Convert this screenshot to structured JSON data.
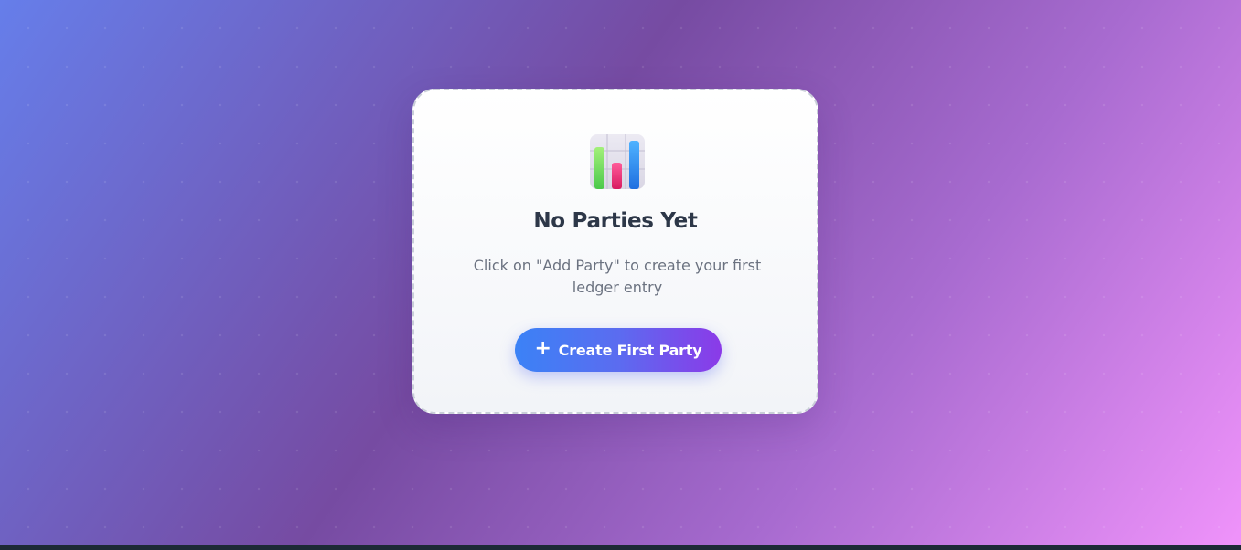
{
  "empty_state": {
    "icon": "bar-chart-icon",
    "title": "No Parties Yet",
    "description": "Click on \"Add Party\" to create your first ledger entry",
    "button": {
      "icon": "plus-icon",
      "icon_glyph": "+",
      "label": "Create First Party"
    }
  },
  "colors": {
    "background_start": "#667eea",
    "background_mid": "#764ba2",
    "background_end": "#f093fb",
    "button_start": "#3b82f6",
    "button_end": "#8b3ae8",
    "title": "#2d3748",
    "description": "#6b7280"
  }
}
